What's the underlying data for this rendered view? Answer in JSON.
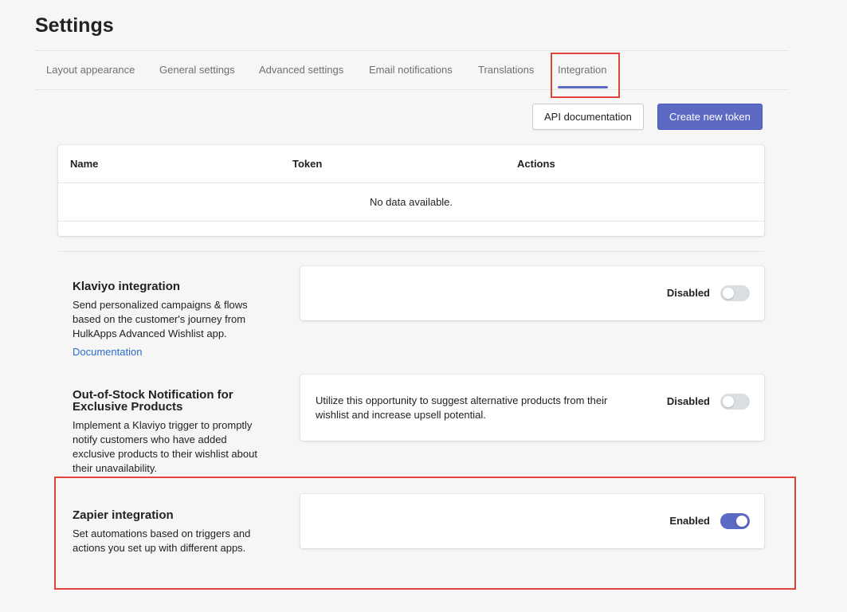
{
  "page": {
    "title": "Settings"
  },
  "tabs": [
    {
      "label": "Layout appearance"
    },
    {
      "label": "General settings"
    },
    {
      "label": "Advanced settings"
    },
    {
      "label": "Email notifications"
    },
    {
      "label": "Translations"
    },
    {
      "label": "Integration",
      "active": true
    }
  ],
  "toolbar": {
    "api_docs_label": "API documentation",
    "create_token_label": "Create new token"
  },
  "tokens_table": {
    "columns": [
      "Name",
      "Token",
      "Actions"
    ],
    "rows": [],
    "empty_message": "No data available."
  },
  "integrations": [
    {
      "title": "Klaviyo integration",
      "description": "Send personalized campaigns & flows based on the customer's journey from HulkApps Advanced Wishlist app.",
      "link_label": "Documentation",
      "card_text": "",
      "status": "Disabled",
      "enabled": false
    },
    {
      "title": "Out-of-Stock Notification for Exclusive Products",
      "description": "Implement a Klaviyo trigger to promptly notify customers who have added exclusive products to their wishlist about their unavailability.",
      "card_text": "Utilize this opportunity to suggest alternative products from their wishlist and increase upsell potential.",
      "status": "Disabled",
      "enabled": false
    },
    {
      "title": "Zapier integration",
      "description": "Set automations based on triggers and actions you set up with different apps.",
      "card_text": "",
      "status": "Enabled",
      "enabled": true
    }
  ],
  "colors": {
    "accent": "#5c6ac4",
    "highlight": "#e0443a",
    "link": "#2c6ecb",
    "toggle_off": "#dcdfe2"
  }
}
